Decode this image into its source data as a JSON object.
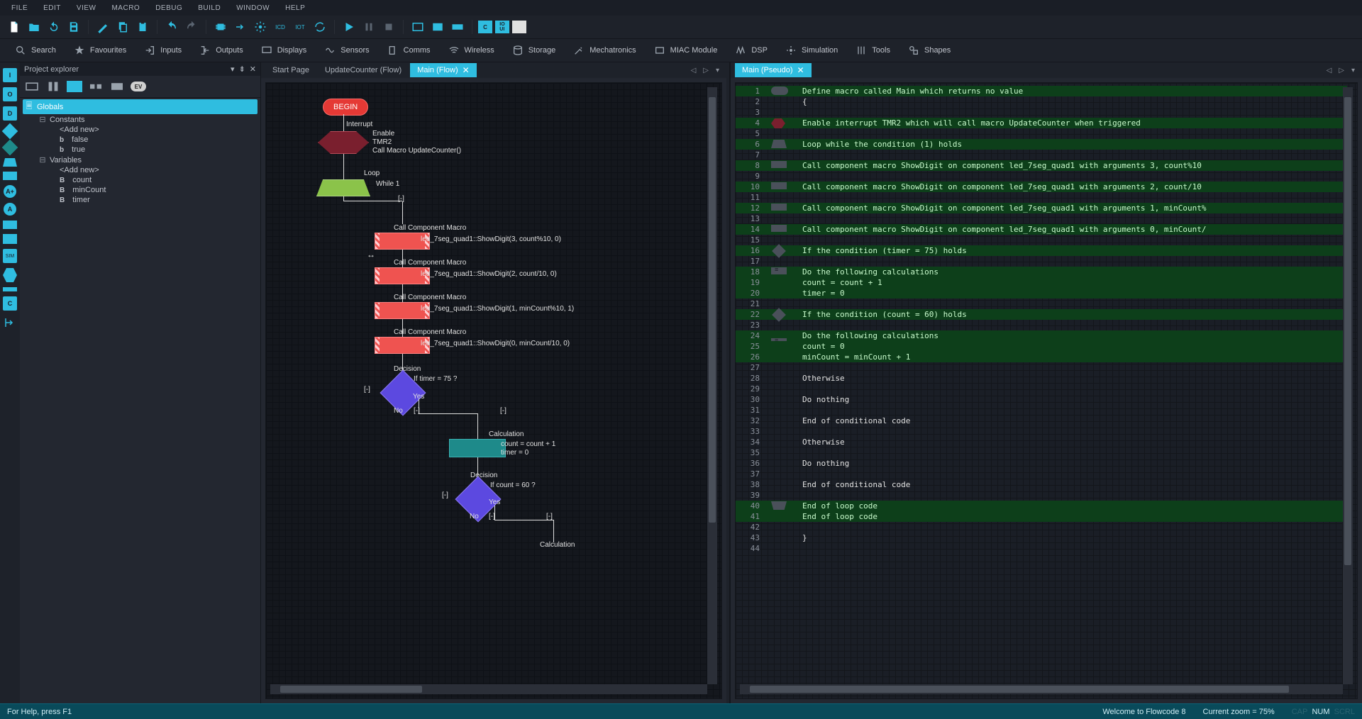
{
  "menu": [
    "FILE",
    "EDIT",
    "VIEW",
    "MACRO",
    "DEBUG",
    "BUILD",
    "WINDOW",
    "HELP"
  ],
  "component_toolbar": [
    {
      "icon": "search",
      "label": "Search"
    },
    {
      "icon": "star",
      "label": "Favourites"
    },
    {
      "icon": "inputs",
      "label": "Inputs"
    },
    {
      "icon": "outputs",
      "label": "Outputs"
    },
    {
      "icon": "display",
      "label": "Displays"
    },
    {
      "icon": "sensors",
      "label": "Sensors"
    },
    {
      "icon": "comms",
      "label": "Comms"
    },
    {
      "icon": "wireless",
      "label": "Wireless"
    },
    {
      "icon": "storage",
      "label": "Storage"
    },
    {
      "icon": "mech",
      "label": "Mechatronics"
    },
    {
      "icon": "miac",
      "label": "MIAC Module"
    },
    {
      "icon": "dsp",
      "label": "DSP"
    },
    {
      "icon": "sim",
      "label": "Simulation"
    },
    {
      "icon": "tools",
      "label": "Tools"
    },
    {
      "icon": "shapes",
      "label": "Shapes"
    }
  ],
  "explorer": {
    "title": "Project explorer",
    "root": "Globals",
    "groups": [
      {
        "label": "Constants",
        "items": [
          "<Add new>",
          "false",
          "true"
        ],
        "prefix": "b"
      },
      {
        "label": "Variables",
        "items": [
          "<Add new>",
          "count",
          "minCount",
          "timer"
        ],
        "prefix": "B"
      }
    ]
  },
  "tabs_left": {
    "items": [
      {
        "label": "Start Page",
        "active": false,
        "closable": false
      },
      {
        "label": "UpdateCounter (Flow)",
        "active": false,
        "closable": false
      },
      {
        "label": "Main (Flow)",
        "active": true,
        "closable": true
      }
    ]
  },
  "tabs_right": {
    "items": [
      {
        "label": "Main (Pseudo)",
        "active": true,
        "closable": true
      }
    ]
  },
  "flow": {
    "begin": "BEGIN",
    "interrupt_title": "Interrupt",
    "interrupt_lines": [
      "Enable",
      "TMR2",
      "Call Macro UpdateCounter()"
    ],
    "loop_title": "Loop",
    "loop_cond": "While 1",
    "loop_marker": "[-]",
    "calls": [
      {
        "title": "Call Component Macro",
        "text": "led_7seg_quad1::ShowDigit(3, count%10, 0)"
      },
      {
        "title": "Call Component Macro",
        "text": "led_7seg_quad1::ShowDigit(2, count/10, 0)"
      },
      {
        "title": "Call Component Macro",
        "text": "led_7seg_quad1::ShowDigit(1, minCount%10, 1)"
      },
      {
        "title": "Call Component Macro",
        "text": "led_7seg_quad1::ShowDigit(0, minCount/10, 0)"
      }
    ],
    "dec1": {
      "title": "Decision",
      "cond": "If  timer = 75 ?",
      "yes": "Yes",
      "no": "No",
      "marker": "[-]"
    },
    "calc1": {
      "title": "Calculation",
      "lines": [
        "count = count + 1",
        "timer = 0"
      ]
    },
    "dec2": {
      "title": "Decision",
      "cond": "If  count = 60 ?",
      "yes": "Yes",
      "no": "No",
      "marker": "[-]"
    },
    "calc2": {
      "title": "Calculation"
    }
  },
  "pseudo": [
    {
      "n": 1,
      "t": "Define macro called Main which returns no value",
      "hl": true,
      "i": "oval"
    },
    {
      "n": 2,
      "t": "{",
      "hl": false
    },
    {
      "n": 3,
      "t": "",
      "hl": false
    },
    {
      "n": 4,
      "t": "    Enable interrupt TMR2 which will call macro UpdateCounter when triggered",
      "hl": true,
      "i": "hex"
    },
    {
      "n": 5,
      "t": "",
      "hl": false
    },
    {
      "n": 6,
      "t": "    Loop while the condition (1) holds",
      "hl": true,
      "i": "looptop"
    },
    {
      "n": 7,
      "t": "",
      "hl": false
    },
    {
      "n": 8,
      "t": "        Call component macro ShowDigit on component led_7seg_quad1 with arguments 3, count%10",
      "hl": true,
      "i": "rect"
    },
    {
      "n": 9,
      "t": "",
      "hl": false
    },
    {
      "n": 10,
      "t": "        Call component macro ShowDigit on component led_7seg_quad1 with arguments 2, count/10",
      "hl": true,
      "i": "rect"
    },
    {
      "n": 11,
      "t": "",
      "hl": false
    },
    {
      "n": 12,
      "t": "        Call component macro ShowDigit on component led_7seg_quad1 with arguments 1, minCount%",
      "hl": true,
      "i": "rect"
    },
    {
      "n": 13,
      "t": "",
      "hl": false
    },
    {
      "n": 14,
      "t": "        Call component macro ShowDigit on component led_7seg_quad1 with arguments 0, minCount/",
      "hl": true,
      "i": "rect"
    },
    {
      "n": 15,
      "t": "",
      "hl": false
    },
    {
      "n": 16,
      "t": "        If the condition (timer = 75) holds",
      "hl": true,
      "i": "dia"
    },
    {
      "n": 17,
      "t": "",
      "hl": false
    },
    {
      "n": 18,
      "t": "            Do the following calculations",
      "hl": true,
      "i": "calc"
    },
    {
      "n": 19,
      "t": "                count = count + 1",
      "hl": true
    },
    {
      "n": 20,
      "t": "                timer = 0",
      "hl": true
    },
    {
      "n": 21,
      "t": "",
      "hl": false
    },
    {
      "n": 22,
      "t": "            If the condition (count = 60) holds",
      "hl": true,
      "i": "dia"
    },
    {
      "n": 23,
      "t": "",
      "hl": false
    },
    {
      "n": 24,
      "t": "                Do the following calculations",
      "hl": true,
      "i": "calc"
    },
    {
      "n": 25,
      "t": "                    count = 0",
      "hl": true
    },
    {
      "n": 26,
      "t": "                    minCount = minCount + 1",
      "hl": true
    },
    {
      "n": 27,
      "t": "",
      "hl": false
    },
    {
      "n": 28,
      "t": "            Otherwise",
      "hl": false
    },
    {
      "n": 29,
      "t": "",
      "hl": false
    },
    {
      "n": 30,
      "t": "                Do nothing",
      "hl": false
    },
    {
      "n": 31,
      "t": "",
      "hl": false
    },
    {
      "n": 32,
      "t": "            End of conditional code",
      "hl": false
    },
    {
      "n": 33,
      "t": "",
      "hl": false
    },
    {
      "n": 34,
      "t": "        Otherwise",
      "hl": false
    },
    {
      "n": 35,
      "t": "",
      "hl": false
    },
    {
      "n": 36,
      "t": "            Do nothing",
      "hl": false
    },
    {
      "n": 37,
      "t": "",
      "hl": false
    },
    {
      "n": 38,
      "t": "        End of conditional code",
      "hl": false
    },
    {
      "n": 39,
      "t": "",
      "hl": false
    },
    {
      "n": 40,
      "t": "    End of loop code",
      "hl": true,
      "i": "loopbot"
    },
    {
      "n": 41,
      "t": "    End of loop code",
      "hl": true
    },
    {
      "n": 42,
      "t": "",
      "hl": false
    },
    {
      "n": 43,
      "t": "}",
      "hl": false
    },
    {
      "n": 44,
      "t": "",
      "hl": false
    }
  ],
  "status": {
    "help": "For Help, press F1",
    "welcome": "Welcome to Flowcode 8",
    "zoom": "Current zoom = 75%",
    "cap": "CAP",
    "num": "NUM",
    "scrl": "SCRL"
  }
}
